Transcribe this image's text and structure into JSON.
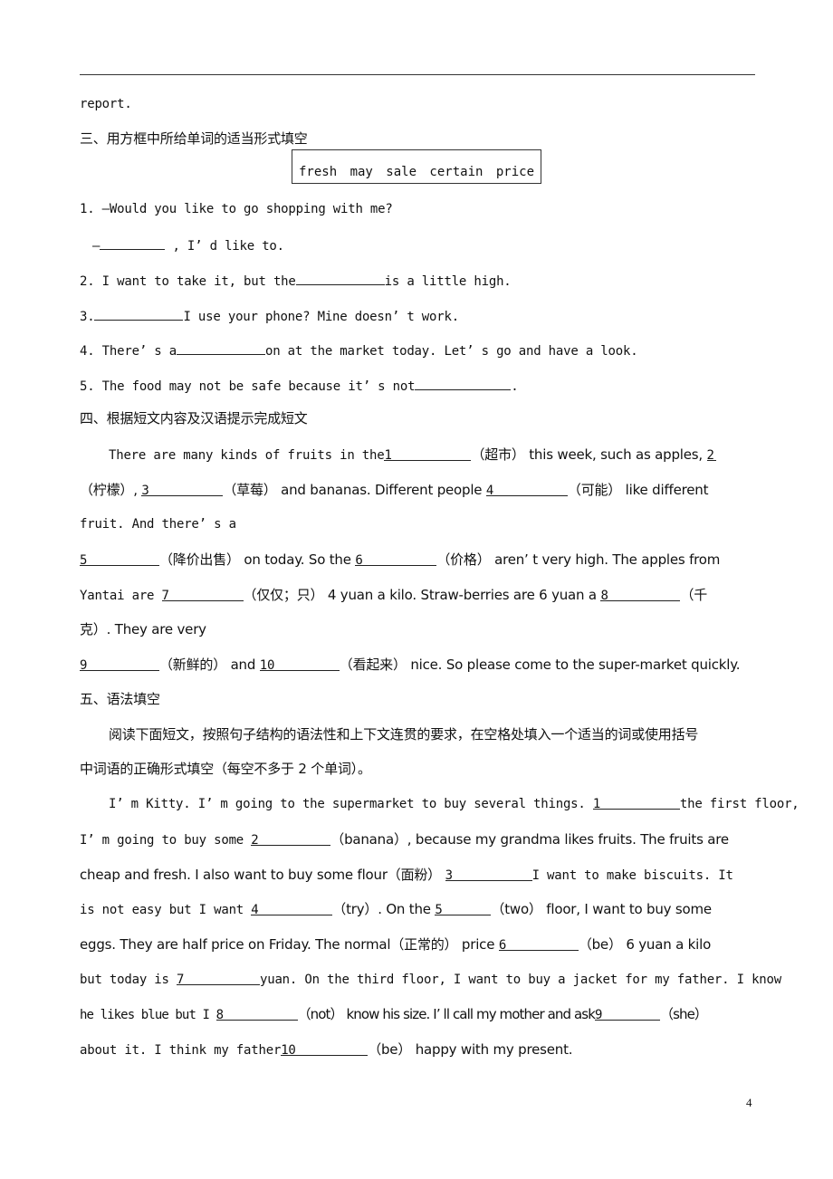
{
  "page": {
    "top_fragment": "report.",
    "page_number": "4"
  },
  "section3": {
    "heading": "三、用方框中所给单词的适当形式填空",
    "word_box": "fresh  may  sale  certain  price",
    "items": [
      {
        "q": "1. —Would you like to go shopping with me?"
      },
      {
        "pre": "—",
        "post": " , I’ d like to."
      },
      {
        "pre": "2. I want to take it, but the",
        "post": "is a little high."
      },
      {
        "pre": "3.",
        "post": "I use your phone? Mine doesn’ t work."
      },
      {
        "pre": "4. There’ s a",
        "post": "on at the market today. Let’ s go and have a look."
      },
      {
        "pre": "5. The food may not be safe because it’ s not",
        "post": "."
      }
    ]
  },
  "section4": {
    "heading": "四、根据短文内容及汉语提示完成短文",
    "lines": [
      {
        "a": "There are many kinds of fruits in the",
        "n1": "1",
        "b": "（超市） this week, such as apples, ",
        "n2": "2"
      },
      {
        "a": "（柠檬）, ",
        "n1": "3",
        "b": "（草莓） and bananas. Different people ",
        "n2": "4",
        "c": "（可能） like different"
      },
      {
        "a": "fruit. And there’ s a"
      },
      {
        "n1": "5",
        "b": "（降价出售） on today. So the ",
        "n2": "6",
        "c": "（价格） aren’ t very high. The apples from"
      },
      {
        "a": "Yantai are ",
        "n1": "7",
        "b": "（仅仅；只） 4 yuan a kilo. Straw-berries are 6 yuan a ",
        "n2": "8",
        "c": "（千"
      },
      {
        "a": "克）. They are very"
      },
      {
        "n1": "9",
        "b": "（新鲜的） and ",
        "n2": "10",
        "c": "（看起来） nice. So please come to the super-market quickly."
      }
    ]
  },
  "section5": {
    "heading": "五、语法填空",
    "instructions_1": "阅读下面短文，按照句子结构的语法性和上下文连贯的要求，在空格处填入一个适当的词或使用括号",
    "instructions_2": "中词语的正确形式填空（每空不多于 2 个单词）。",
    "lines": [
      {
        "a": "I’ m Kitty. I’ m going to the supermarket to buy several things. ",
        "n1": "1",
        "b": "the first floor,"
      },
      {
        "a": "I’ m going to buy some ",
        "n1": "2",
        "b": "（banana）, because my grandma likes fruits. The fruits are"
      },
      {
        "a": "cheap and fresh. I also want to buy some flour（面粉） ",
        "n1": "3",
        "b": "I want to make biscuits.  It"
      },
      {
        "a": "is not easy but I want ",
        "n1": "4",
        "b": "（try）. On the ",
        "n2": "5",
        "c": "（two） floor, I want to buy some"
      },
      {
        "a": "eggs. They are half price on Friday. The normal（正常的） price ",
        "n1": "6",
        "b": "（be） 6 yuan a kilo"
      },
      {
        "a": "but today is ",
        "n1": "7",
        "b": "yuan. On the third floor, I want to buy a jacket for my father. I know"
      },
      {
        "a": "he likes blue but I ",
        "n1": "8",
        "b": "（not） know his size. I’ ll call my mother and ask",
        "n2": "9",
        "c": "（she）"
      },
      {
        "a": "about it. I think my father",
        "n1": "10",
        "b": "（be） happy with my present."
      }
    ]
  }
}
